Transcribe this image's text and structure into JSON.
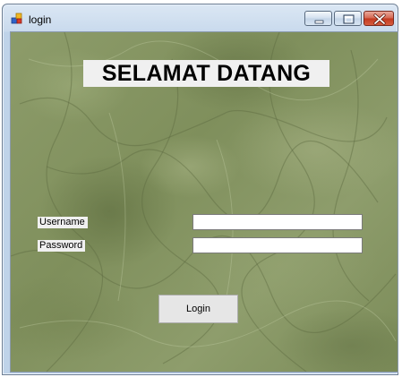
{
  "window": {
    "title": "login"
  },
  "main": {
    "heading": "SELAMAT DATANG",
    "username_label": "Username",
    "password_label": "Password",
    "username_value": "",
    "password_value": "",
    "login_button": "Login"
  },
  "icons": {
    "app": "app-icon",
    "minimize": "minimize-icon",
    "maximize": "maximize-icon",
    "close": "close-icon"
  }
}
